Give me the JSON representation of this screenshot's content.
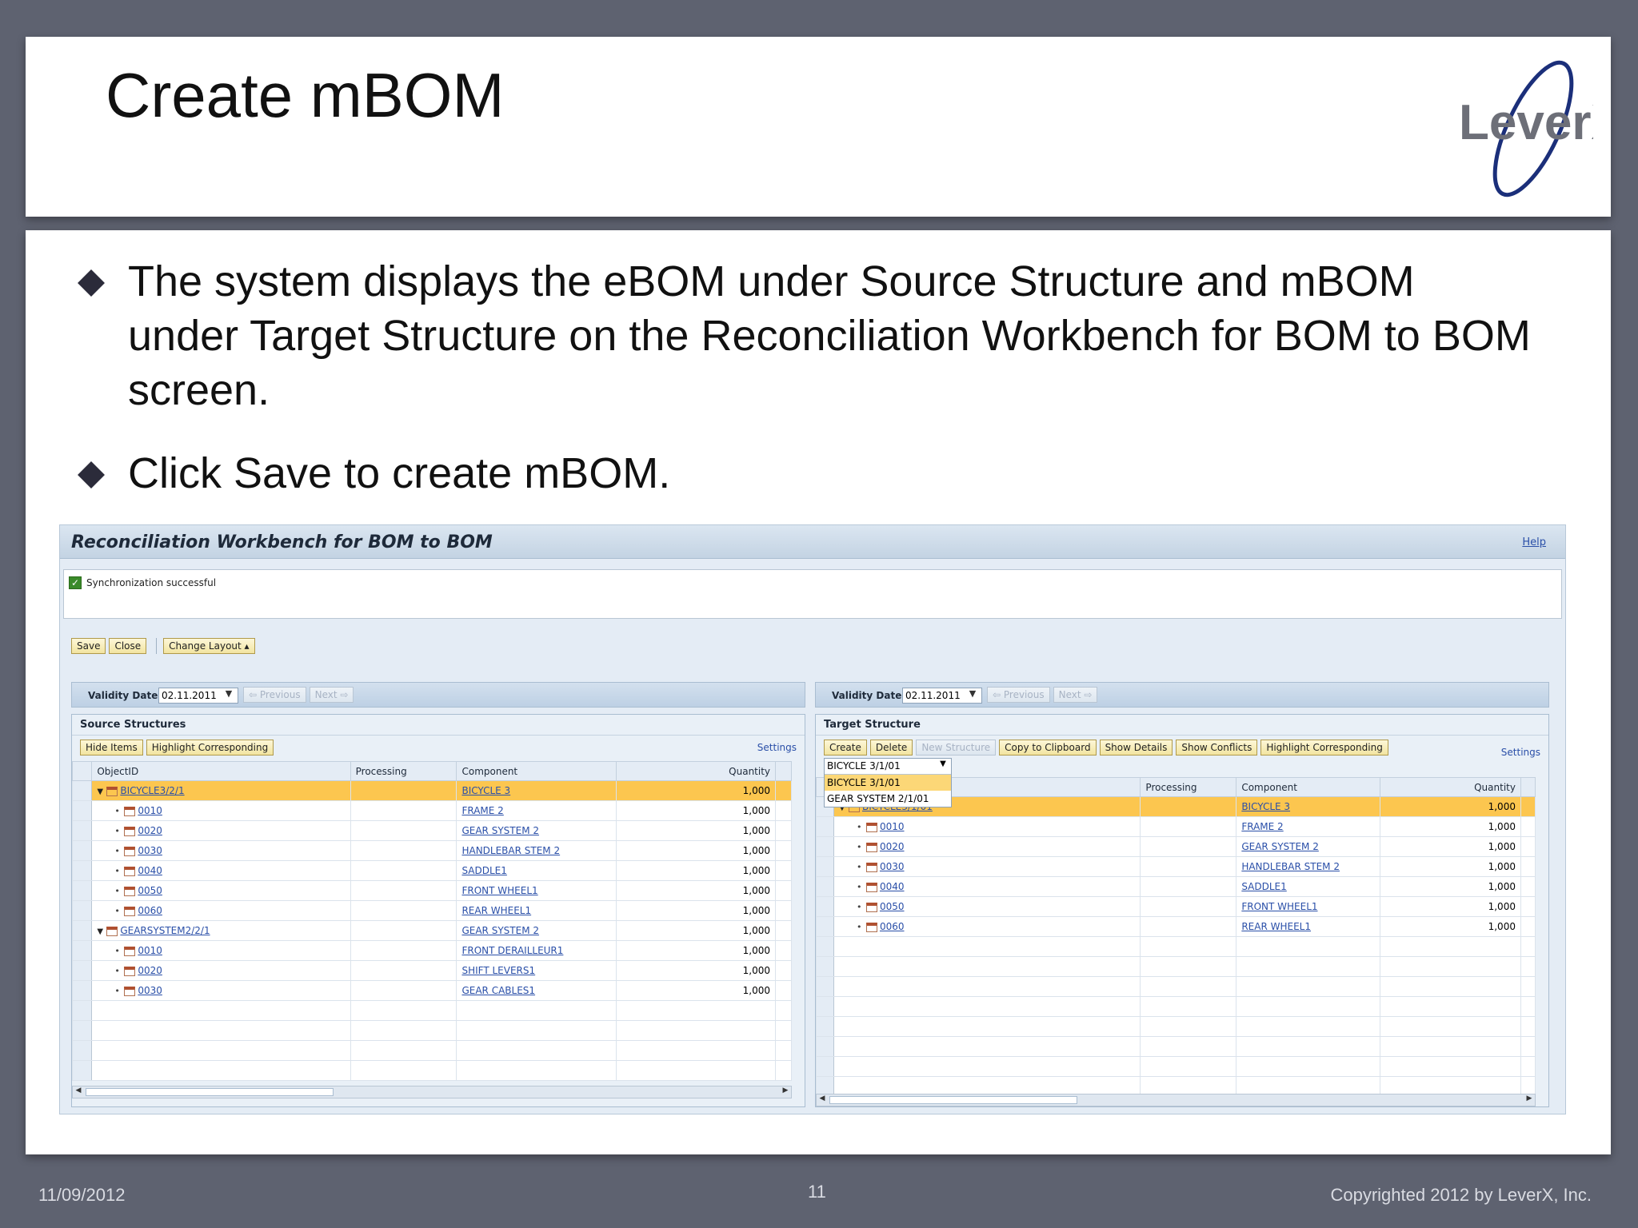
{
  "slide": {
    "title": "Create mBOM",
    "logo_text": "LeverX",
    "bullets": [
      "The system displays the eBOM under Source Structure and mBOM under Target Structure on the Reconciliation Workbench for BOM to BOM screen.",
      "Click Save to create mBOM."
    ],
    "footer": {
      "date": "11/09/2012",
      "page": "11",
      "copyright": "Copyrighted 2012 by LeverX, Inc."
    }
  },
  "sap": {
    "title": "Reconciliation Workbench for BOM to BOM",
    "help": "Help",
    "message": "Synchronization successful",
    "toolbar": {
      "save": "Save",
      "close": "Close",
      "change_layout": "Change Layout ▴"
    },
    "validity_label": "Validity Date",
    "validity_date": "02.11.2011",
    "previous": "⇦ Previous",
    "next": "Next ⇨",
    "settings": "Settings",
    "source": {
      "title": "Source Structures",
      "buttons": {
        "hide_items": "Hide Items",
        "highlight": "Highlight Corresponding"
      },
      "columns": [
        "ObjectID",
        "Processing",
        "Component",
        "Quantity"
      ],
      "rows": [
        {
          "object": "BICYCLE3/2/1",
          "component": "BICYCLE 3",
          "qty": "1,000"
        },
        {
          "object": "0010",
          "component": "FRAME 2",
          "qty": "1,000"
        },
        {
          "object": "0020",
          "component": "GEAR SYSTEM 2",
          "qty": "1,000"
        },
        {
          "object": "0030",
          "component": "HANDLEBAR STEM 2",
          "qty": "1,000"
        },
        {
          "object": "0040",
          "component": "SADDLE1",
          "qty": "1,000"
        },
        {
          "object": "0050",
          "component": "FRONT WHEEL1",
          "qty": "1,000"
        },
        {
          "object": "0060",
          "component": "REAR WHEEL1",
          "qty": "1,000"
        },
        {
          "object": "GEARSYSTEM2/2/1",
          "component": "GEAR SYSTEM 2",
          "qty": "1,000"
        },
        {
          "object": "0010",
          "component": "FRONT DERAILLEUR1",
          "qty": "1,000"
        },
        {
          "object": "0020",
          "component": "SHIFT LEVERS1",
          "qty": "1,000"
        },
        {
          "object": "0030",
          "component": "GEAR CABLES1",
          "qty": "1,000"
        }
      ]
    },
    "target": {
      "title": "Target Structure",
      "buttons": {
        "create": "Create",
        "delete": "Delete",
        "new_structure": "New Structure",
        "copy": "Copy to Clipboard",
        "show_details": "Show Details",
        "show_conflicts": "Show Conflicts",
        "highlight": "Highlight Corresponding"
      },
      "dropdown": {
        "selected": "BICYCLE 3/1/01",
        "options": [
          "BICYCLE 3/1/01",
          "GEAR SYSTEM 2/1/01"
        ]
      },
      "columns": [
        "Processing",
        "Component",
        "Quantity"
      ],
      "rows": [
        {
          "object": "BICYCLE3/1/01",
          "component": "BICYCLE 3",
          "qty": "1,000"
        },
        {
          "object": "0010",
          "component": "FRAME 2",
          "qty": "1,000"
        },
        {
          "object": "0020",
          "component": "GEAR SYSTEM 2",
          "qty": "1,000"
        },
        {
          "object": "0030",
          "component": "HANDLEBAR STEM 2",
          "qty": "1,000"
        },
        {
          "object": "0040",
          "component": "SADDLE1",
          "qty": "1,000"
        },
        {
          "object": "0050",
          "component": "FRONT WHEEL1",
          "qty": "1,000"
        },
        {
          "object": "0060",
          "component": "REAR WHEEL1",
          "qty": "1,000"
        }
      ]
    }
  }
}
